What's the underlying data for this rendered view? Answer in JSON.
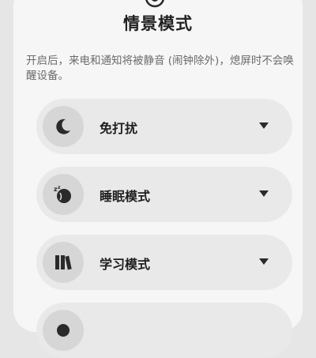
{
  "header": {
    "title": "情景模式"
  },
  "description": "开启后，来电和通知将被静音 (闹钟除外)，熄屏时不会唤醒设备。",
  "modes": [
    {
      "label": "免打扰",
      "icon": "moon-icon"
    },
    {
      "label": "睡眠模式",
      "icon": "sleep-icon"
    },
    {
      "label": "学习模式",
      "icon": "books-icon"
    },
    {
      "label": "",
      "icon": "mode-icon"
    }
  ],
  "colors": {
    "background": "#e6e6e6",
    "sheet": "#f6f6f6",
    "row": "#e9e9e9",
    "icon_circle": "#d6d6d6",
    "icon": "#2a2a2a"
  }
}
